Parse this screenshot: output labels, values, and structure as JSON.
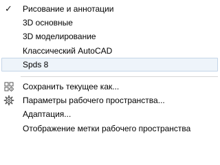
{
  "workspace_menu": {
    "workspaces": [
      {
        "label": "Рисование и аннотации",
        "checked": true
      },
      {
        "label": "3D основные",
        "checked": false
      },
      {
        "label": "3D моделирование",
        "checked": false
      },
      {
        "label": "Классический AutoCAD",
        "checked": false
      },
      {
        "label": "Spds 8",
        "checked": false,
        "highlighted": true
      }
    ],
    "actions": [
      {
        "label": "Сохранить текущее как...",
        "icon": "save-workspace-icon"
      },
      {
        "label": "Параметры рабочего пространства...",
        "icon": "gear-icon"
      },
      {
        "label": "Адаптация...",
        "icon": ""
      },
      {
        "label": "Отображение метки рабочего пространства",
        "icon": ""
      }
    ],
    "checkmark_glyph": "✓",
    "colors": {
      "highlight_bg": "#eef4fa",
      "highlight_border": "#c4d5e8",
      "separator": "#d6d6d6",
      "text": "#000000"
    }
  }
}
